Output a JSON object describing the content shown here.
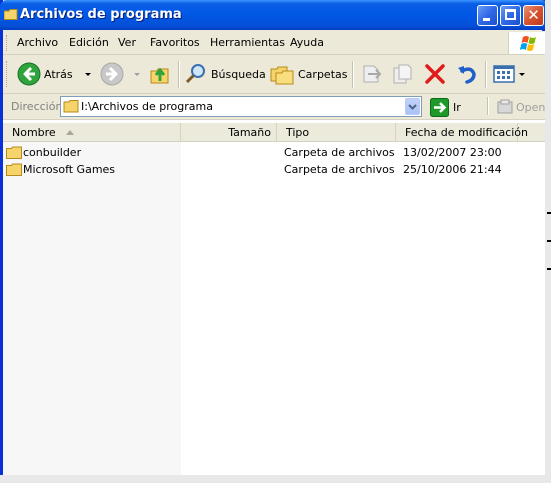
{
  "window": {
    "title": "Archivos de programa"
  },
  "menu": {
    "items": [
      "Archivo",
      "Edición",
      "Ver",
      "Favoritos",
      "Herramientas",
      "Ayuda"
    ]
  },
  "toolbar": {
    "back_label": "Atrás",
    "search_label": "Búsqueda",
    "folders_label": "Carpetas"
  },
  "address": {
    "label": "Dirección",
    "value": "I:\\Archivos de programa",
    "go_label": "Ir",
    "open_label": "Open"
  },
  "columns": [
    "Nombre",
    "Tamaño",
    "Tipo",
    "Fecha de modificación"
  ],
  "rows": [
    {
      "name": "conbuilder",
      "size": "",
      "type": "Carpeta de archivos",
      "modified": "13/02/2007 23:00"
    },
    {
      "name": "Microsoft Games",
      "size": "",
      "type": "Carpeta de archivos",
      "modified": "25/10/2006 21:44"
    }
  ],
  "icons": {
    "title": "folder-icon",
    "back": "back-arrow-icon",
    "forward": "forward-arrow-icon",
    "up": "up-folder-icon",
    "search": "magnifier-icon",
    "folders": "folders-icon",
    "move": "move-to-icon",
    "copy": "copy-to-icon",
    "delete": "delete-x-icon",
    "undo": "undo-icon",
    "views": "views-icon",
    "go": "go-arrow-icon",
    "windows_logo": "windows-logo-icon"
  },
  "colors": {
    "title_bar": "#0058e6",
    "close_button": "#d6532f",
    "delete_x": "#e01b1b",
    "go_green": "#1e9a2a"
  }
}
